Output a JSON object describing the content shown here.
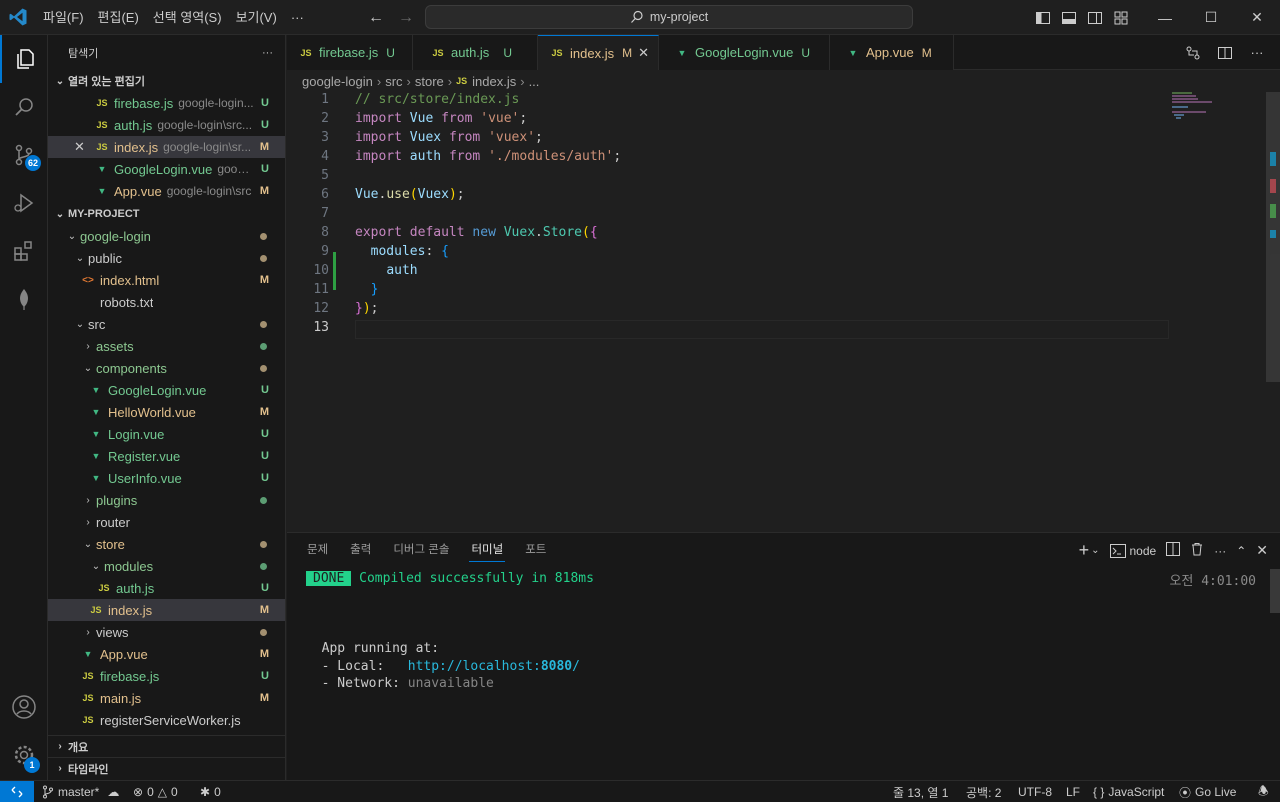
{
  "titlebar": {
    "menu": [
      "파일(F)",
      "편집(E)",
      "선택 영역(S)",
      "보기(V)",
      "···"
    ],
    "search": "my-project"
  },
  "activity": {
    "scm_badge": "62",
    "settings_badge": "1"
  },
  "sidebar": {
    "title": "탐색기",
    "more": "···",
    "open_editors": {
      "title": "열려 있는 편집기",
      "items": [
        {
          "icon": "JS",
          "name": "firebase.js",
          "desc": "google-login...",
          "status": "U"
        },
        {
          "icon": "JS",
          "name": "auth.js",
          "desc": "google-login\\src...",
          "status": "U"
        },
        {
          "icon": "JS",
          "name": "index.js",
          "desc": "google-login\\sr...",
          "status": "M"
        },
        {
          "icon": "V",
          "name": "GoogleLogin.vue",
          "desc": "googl...",
          "status": "U"
        },
        {
          "icon": "V",
          "name": "App.vue",
          "desc": "google-login\\src",
          "status": "M"
        }
      ]
    },
    "project": {
      "title": "MY-PROJECT",
      "tree": [
        {
          "name": "google-login"
        },
        {
          "name": "public"
        },
        {
          "name": "index.html",
          "icon": "<>",
          "status": "M"
        },
        {
          "name": "robots.txt"
        },
        {
          "name": "src"
        },
        {
          "name": "assets"
        },
        {
          "name": "components"
        },
        {
          "name": "GoogleLogin.vue",
          "icon": "V",
          "status": "U"
        },
        {
          "name": "HelloWorld.vue",
          "icon": "V",
          "status": "M"
        },
        {
          "name": "Login.vue",
          "icon": "V",
          "status": "U"
        },
        {
          "name": "Register.vue",
          "icon": "V",
          "status": "U"
        },
        {
          "name": "UserInfo.vue",
          "icon": "V",
          "status": "U"
        },
        {
          "name": "plugins"
        },
        {
          "name": "router"
        },
        {
          "name": "store"
        },
        {
          "name": "modules"
        },
        {
          "name": "auth.js",
          "icon": "JS",
          "status": "U"
        },
        {
          "name": "index.js",
          "icon": "JS",
          "status": "M"
        },
        {
          "name": "views"
        },
        {
          "name": "App.vue",
          "icon": "V",
          "status": "M"
        },
        {
          "name": "firebase.js",
          "icon": "JS",
          "status": "U"
        },
        {
          "name": "main.js",
          "icon": "JS",
          "status": "M"
        },
        {
          "name": "registerServiceWorker.js",
          "icon": "JS"
        }
      ]
    },
    "outline": "개요",
    "timeline": "타임라인"
  },
  "tabs": [
    {
      "icon": "JS",
      "label": "firebase.js",
      "status": "U"
    },
    {
      "icon": "JS",
      "label": "auth.js",
      "status": "U"
    },
    {
      "icon": "JS",
      "label": "index.js",
      "status": "M"
    },
    {
      "icon": "V",
      "label": "GoogleLogin.vue",
      "status": "U"
    },
    {
      "icon": "V",
      "label": "App.vue",
      "status": "M"
    }
  ],
  "breadcrumb": [
    "google-login",
    "src",
    "store",
    "index.js",
    "..."
  ],
  "editor": {
    "line_numbers": [
      "1",
      "2",
      "3",
      "4",
      "5",
      "6",
      "7",
      "8",
      "9",
      "10",
      "11",
      "12",
      "13"
    ]
  },
  "panel": {
    "tabs": [
      "문제",
      "출력",
      "디버그 콘솔",
      "터미널",
      "포트"
    ],
    "shell": "node",
    "done": "DONE",
    "compiled": "Compiled successfully in 818ms",
    "time": "오전 4:01:00",
    "app_running": "App running at:",
    "local_label": "- Local:   ",
    "local_url": "http://localhost:",
    "local_port": "8080",
    "local_slash": "/",
    "network_label": "- Network: ",
    "network_value": "unavailable"
  },
  "status": {
    "branch": "master*",
    "errors": "0",
    "warnings": "0",
    "ports": "0",
    "position": "줄 13, 열 1",
    "indent": "공백: 2",
    "encoding": "UTF-8",
    "eol": "LF",
    "language": "JavaScript",
    "golive": "Go Live"
  }
}
